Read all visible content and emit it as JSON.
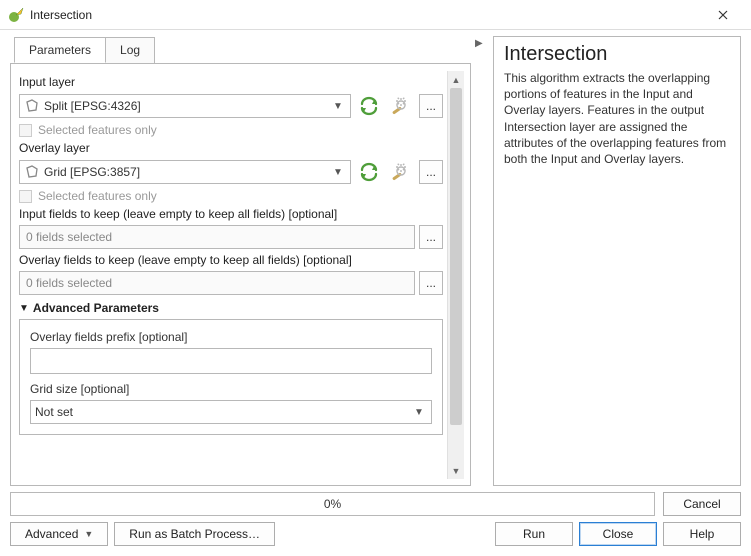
{
  "titlebar": {
    "title": "Intersection"
  },
  "tabs": {
    "parameters": "Parameters",
    "log": "Log"
  },
  "params": {
    "input_layer_label": "Input layer",
    "input_layer_value": "Split [EPSG:4326]",
    "input_selected_only": "Selected features only",
    "overlay_layer_label": "Overlay layer",
    "overlay_layer_value": "Grid [EPSG:3857]",
    "overlay_selected_only": "Selected features only",
    "input_fields_label": "Input fields to keep (leave empty to keep all fields) [optional]",
    "input_fields_value": "0 fields selected",
    "overlay_fields_label": "Overlay fields to keep (leave empty to keep all fields) [optional]",
    "overlay_fields_value": "0 fields selected",
    "advanced_header": "Advanced Parameters",
    "overlay_prefix_label": "Overlay fields prefix [optional]",
    "overlay_prefix_value": "",
    "grid_size_label": "Grid size [optional]",
    "grid_size_value": "Not set",
    "dots": "..."
  },
  "help": {
    "title": "Intersection",
    "body": "This algorithm extracts the overlapping portions of features in the Input and Overlay layers. Features in the output Intersection layer are assigned the attributes of the overlapping features from both the Input and Overlay layers."
  },
  "progress": {
    "text": "0%"
  },
  "buttons": {
    "cancel": "Cancel",
    "advanced": "Advanced",
    "batch": "Run as Batch Process…",
    "run": "Run",
    "close": "Close",
    "help": "Help"
  }
}
